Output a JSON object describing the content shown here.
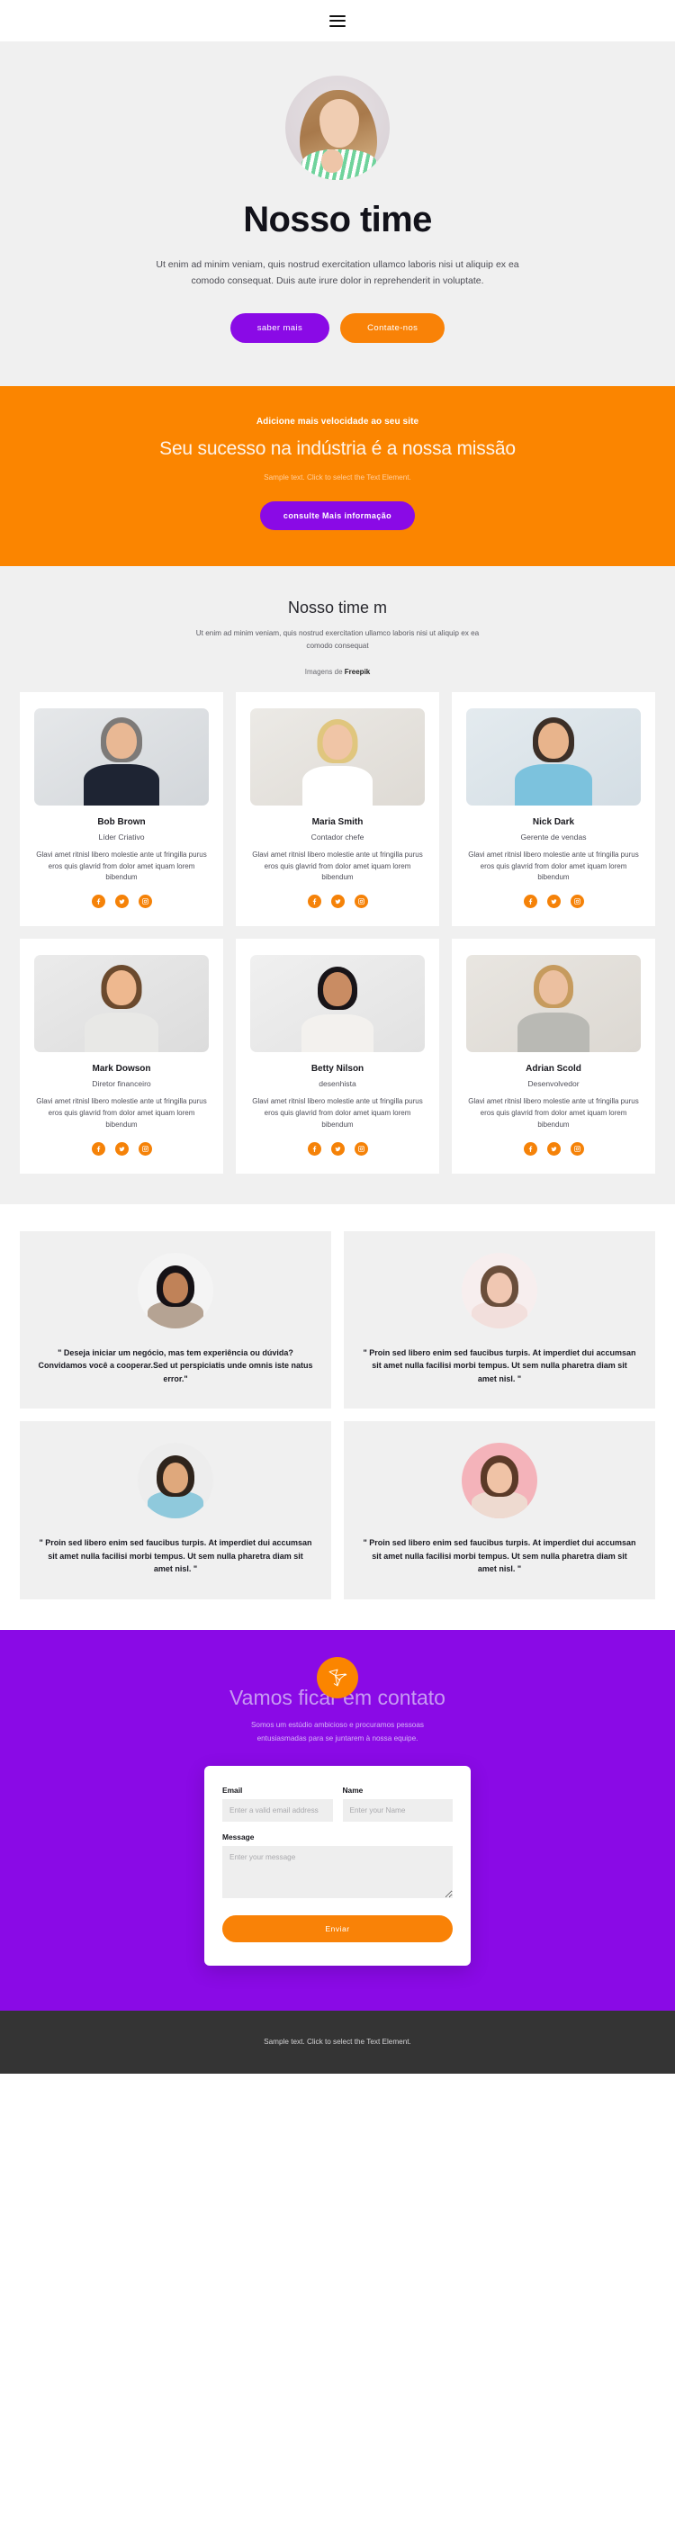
{
  "nav": {
    "menu_icon": "hamburger-menu-icon"
  },
  "hero": {
    "title": "Nosso time",
    "subtitle": "Ut enim ad minim veniam, quis nostrud exercitation ullamco laboris nisi ut aliquip ex ea comodo consequat. Duis aute irure dolor in reprehenderit in voluptate.",
    "primary_button": "saber mais",
    "secondary_button": "Contate-nos",
    "avatar_alt": "hero-portrait"
  },
  "promo": {
    "eyebrow": "Adicione mais velocidade ao seu site",
    "title": "Seu sucesso na indústria é a nossa missão",
    "text": "Sample text. Click to select the Text Element.",
    "button": "consulte Mais informação"
  },
  "team": {
    "title": "Nosso time m",
    "subtitle": "Ut enim ad minim veniam, quis nostrud exercitation ullamco laboris nisi ut aliquip ex ea comodo consequat",
    "credit_prefix": "Imagens de ",
    "credit_brand": "Freepik",
    "bio": "Glavi amet ritnisl libero molestie ante ut fringilla purus eros quis glavrid from dolor amet iquam lorem bibendum",
    "members": [
      {
        "name": "Bob Brown",
        "role": "Líder Criativo",
        "bio": "Glavi amet ritnisl libero molestie ante ut fringilla purus eros quis glavrid from dolor amet iquam lorem bibendum"
      },
      {
        "name": "Maria Smith",
        "role": "Contador chefe",
        "bio": "Glavi amet ritnisl libero molestie ante ut fringilla purus eros quis glavrid from dolor amet iquam lorem bibendum"
      },
      {
        "name": "Nick Dark",
        "role": "Gerente de vendas",
        "bio": "Glavi amet ritnisl libero molestie ante ut fringilla purus eros quis glavrid from dolor amet iquam lorem bibendum"
      },
      {
        "name": "Mark Dowson",
        "role": "Diretor financeiro",
        "bio": "Glavi amet ritnisl libero molestie ante ut fringilla purus eros quis glavrid from dolor amet iquam lorem bibendum"
      },
      {
        "name": "Betty Nilson",
        "role": "desenhista",
        "bio": "Glavi amet ritnisl libero molestie ante ut fringilla purus eros quis glavrid from dolor amet iquam lorem bibendum"
      },
      {
        "name": "Adrian Scold",
        "role": "Desenvolvedor",
        "bio": "Glavi amet ritnisl libero molestie ante ut fringilla purus eros quis glavrid from dolor amet iquam lorem bibendum"
      }
    ],
    "social_icons": [
      "facebook-icon",
      "twitter-icon",
      "instagram-icon"
    ]
  },
  "testimonials": [
    {
      "quote": "\" Deseja iniciar um negócio, mas tem experiência ou dúvida? Convidamos você a cooperar.Sed ut perspiciatis unde omnis iste natus error.\""
    },
    {
      "quote": "\" Proin sed libero enim sed faucibus turpis. At imperdiet dui accumsan sit amet nulla facilisi morbi tempus. Ut sem nulla pharetra diam sit amet nisl. \""
    },
    {
      "quote": "\" Proin sed libero enim sed faucibus turpis. At imperdiet dui accumsan sit amet nulla facilisi morbi tempus. Ut sem nulla pharetra diam sit amet nisl. \""
    },
    {
      "quote": "\" Proin sed libero enim sed faucibus turpis. At imperdiet dui accumsan sit amet nulla facilisi morbi tempus. Ut sem nulla pharetra diam sit amet nisl. \""
    }
  ],
  "contact": {
    "icon": "origami-bird-icon",
    "title": "Vamos ficar em contato",
    "text": "Somos um estúdio ambicioso e procuramos pessoas entusiasmadas para se juntarem à nossa equipe.",
    "form": {
      "email_label": "Email",
      "email_placeholder": "Enter a valid email address",
      "name_label": "Name",
      "name_placeholder": "Enter your Name",
      "message_label": "Message",
      "message_placeholder": "Enter your message",
      "submit_label": "Enviar"
    }
  },
  "footer": {
    "text": "Sample text. Click to select the Text Element."
  },
  "colors": {
    "purple": "#8a0ae6",
    "orange": "#fb8500",
    "page_bg": "#f0f0f0",
    "footer_bg": "#343434"
  }
}
